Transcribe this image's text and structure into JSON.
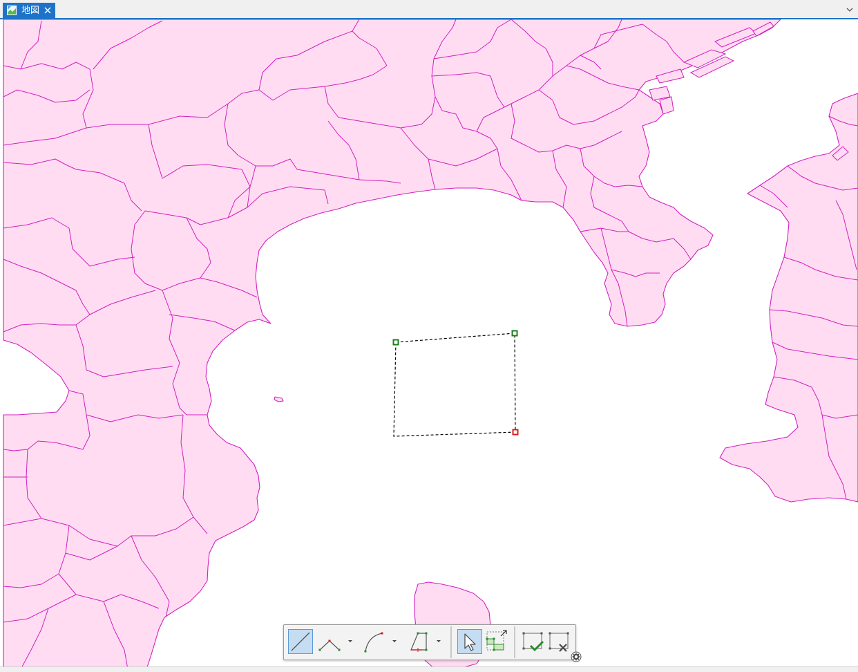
{
  "tab": {
    "label": "地図",
    "active_color": "#1e73c9"
  },
  "map": {
    "land_color": "#ffdcf1",
    "boundary_color": "#d21fc1",
    "water_color": "#ffffff"
  },
  "sketch": {
    "vertex_color": "#1a7f1a",
    "end_vertex_color": "#d81e1e"
  },
  "toolbar": {
    "tools": [
      {
        "name": "line-segment",
        "icon": "line-icon",
        "active": true
      },
      {
        "name": "vertex",
        "icon": "vertex-icon",
        "has_dropdown": true
      },
      {
        "name": "arc",
        "icon": "arc-icon",
        "has_dropdown": true
      },
      {
        "name": "right-angle",
        "icon": "right-angle-icon",
        "has_dropdown": true
      },
      {
        "name": "select",
        "icon": "pointer-icon",
        "active": true
      },
      {
        "name": "edit-vertices",
        "icon": "edit-vertices-icon"
      },
      {
        "name": "finish-sketch",
        "icon": "finish-icon"
      },
      {
        "name": "cancel-sketch",
        "icon": "cancel-icon"
      }
    ]
  }
}
